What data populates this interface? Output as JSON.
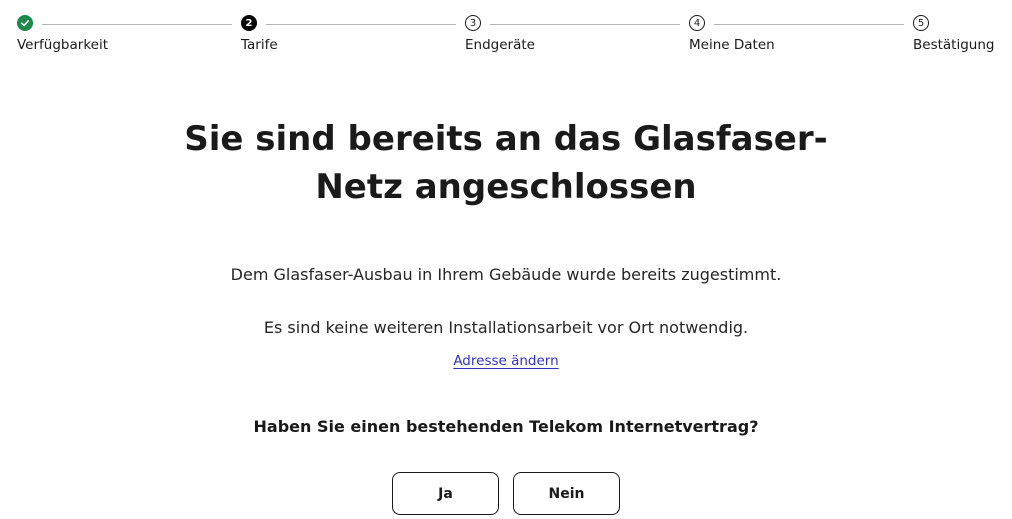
{
  "stepper": {
    "steps": [
      {
        "number": "1",
        "label": "Verfügbarkeit",
        "state": "done",
        "icon": "check-icon"
      },
      {
        "number": "2",
        "label": "Tarife",
        "state": "active"
      },
      {
        "number": "3",
        "label": "Endgeräte",
        "state": "todo"
      },
      {
        "number": "4",
        "label": "Meine Daten",
        "state": "todo"
      },
      {
        "number": "5",
        "label": "Bestätigung",
        "state": "todo"
      }
    ],
    "colors": {
      "done": "#1d8a4a",
      "active": "#000000",
      "line": "#b7b7b7"
    }
  },
  "main": {
    "title_line1": "Sie sind bereits an das Glasfaser-",
    "title_line2": "Netz angeschlossen",
    "text1": "Dem Glasfaser-Ausbau in Ihrem Gebäude wurde bereits zugestimmt.",
    "text2": "Es sind keine weiteren Installationsarbeit vor Ort notwendig.",
    "change_address_link": "Adresse ändern",
    "question": "Haben Sie einen bestehenden Telekom Internetvertrag?",
    "yes_button": "Ja",
    "no_button": "Nein",
    "link_color": "#3131c4"
  }
}
